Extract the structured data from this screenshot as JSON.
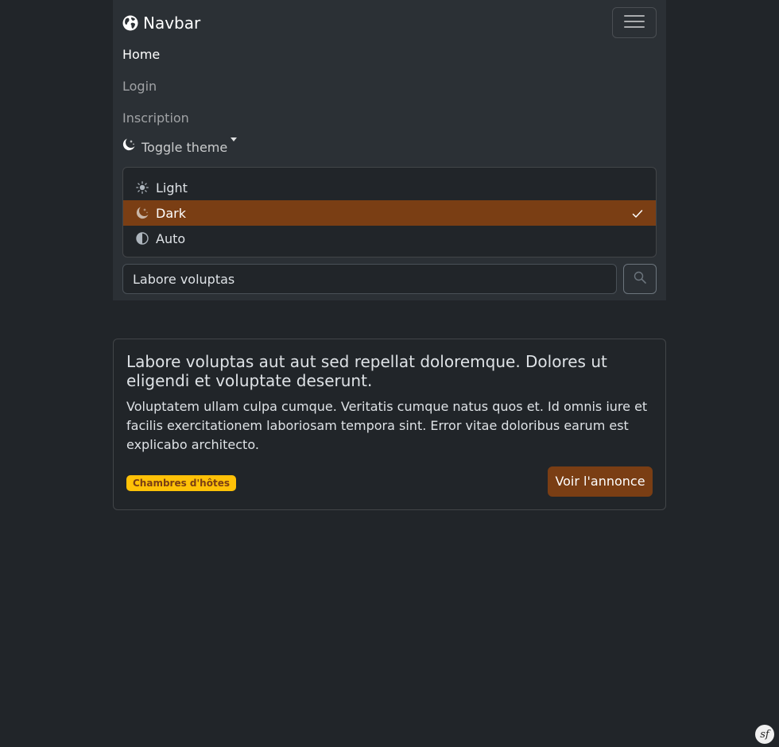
{
  "navbar": {
    "brand": "Navbar",
    "brand_icon": "globe-icon",
    "toggler_icon": "hamburger-icon",
    "links": [
      {
        "label": "Home",
        "active": true
      },
      {
        "label": "Login",
        "active": false
      },
      {
        "label": "Inscription",
        "active": false
      }
    ],
    "theme_toggle": {
      "label": "Toggle theme",
      "icon": "moon-stars-icon",
      "options": [
        {
          "label": "Light",
          "icon": "sun-icon",
          "active": false
        },
        {
          "label": "Dark",
          "icon": "moon-stars-icon",
          "active": true
        },
        {
          "label": "Auto",
          "icon": "circle-half-icon",
          "active": false
        }
      ]
    },
    "search": {
      "value": "Labore voluptas",
      "icon": "search-icon"
    }
  },
  "card": {
    "title": "Labore voluptas aut aut sed repellat doloremque. Dolores ut eligendi et voluptate deserunt.",
    "text": "Voluptatem ullam culpa cumque. Veritatis cumque natus quos et. Id omnis iure et facilis exercitationem laboriosam tempora sint. Error vitae doloribus earum est explicabo architecto.",
    "badge": "Chambres d'hôtes",
    "button": "Voir l'annonce"
  },
  "debug_toolbar": {
    "label": "sf"
  },
  "colors": {
    "body_bg": "#212529",
    "navbar_bg": "#2b3035",
    "primary": "#7a3e14",
    "badge_bg": "#ffc107"
  }
}
